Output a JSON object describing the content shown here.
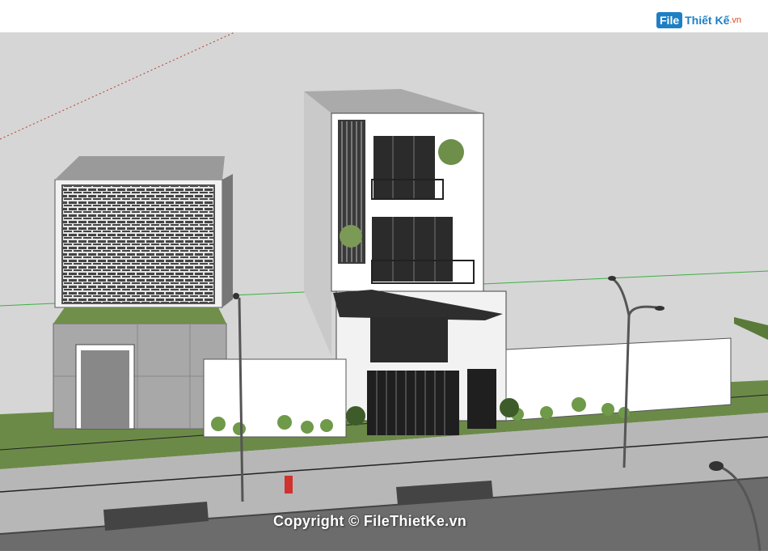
{
  "logo": {
    "box_text": "File",
    "brand_text": "Thiết Kế",
    "tld_text": ".vn"
  },
  "watermark": {
    "text": "Copyright © FileThietKe.vn"
  },
  "scene": {
    "description_type": "3d-sketchup-house-render",
    "colors": {
      "sky": "#d6d6d6",
      "road": "#6e6e6e",
      "sidewalk": "#b4b4b4",
      "grass": "#5a7a3a",
      "wall": "#ffffff",
      "window": "#2a2a2a",
      "gate": "#1f1f1f"
    }
  }
}
